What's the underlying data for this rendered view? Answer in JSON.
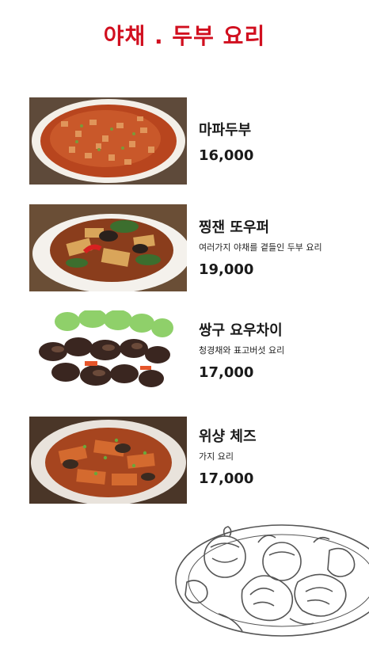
{
  "header": {
    "title": "야채 . 두부 요리",
    "title_color": "#d10f1f"
  },
  "menu": {
    "items": [
      {
        "name": "마파두부",
        "description": "",
        "price": "16,000",
        "image_icon": "mapo-tofu-photo"
      },
      {
        "name": "찡잰 또우퍼",
        "description": "여러가지 야채를 곁들인 두부 요리",
        "price": "19,000",
        "image_icon": "vegetable-tofu-photo"
      },
      {
        "name": "쌍구 요우차이",
        "description": "청경채와 표고버섯 요리",
        "price": "17,000",
        "image_icon": "bokchoy-mushroom-photo"
      },
      {
        "name": "위샹 체즈",
        "description": "가지 요리",
        "price": "17,000",
        "image_icon": "eggplant-photo"
      }
    ]
  },
  "decoration": {
    "icon": "shrimp-plate-illustration"
  }
}
